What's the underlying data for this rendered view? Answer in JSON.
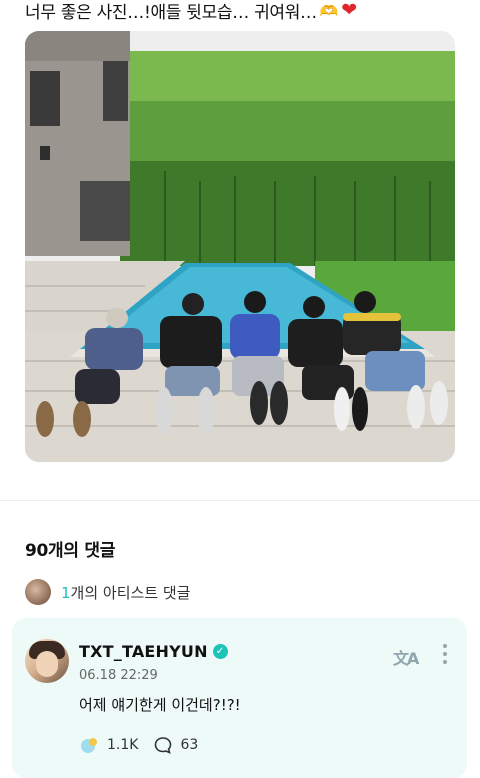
{
  "post": {
    "text": "너무 좋은 사진…!애들 뒷모습… 귀여워…",
    "emoji_hands": "🫶",
    "emoji_heart": "❤"
  },
  "photo_icon": "pool-photo",
  "comments_section": {
    "count_label": "90개의 댓글",
    "artist_comment_count": "1",
    "artist_comment_label": "개의 아티스트 댓글"
  },
  "comment": {
    "username": "TXT_TAEHYUN",
    "verified_icon": "verified-badge-icon",
    "timestamp": "06.18 22:29",
    "text": "어제 얘기한게 이건데?!?!",
    "translate_label": "文A",
    "likes": "1.1K",
    "replies": "63"
  },
  "colors": {
    "accent": "#1ec3b8",
    "card_bg": "#eefaf8"
  }
}
